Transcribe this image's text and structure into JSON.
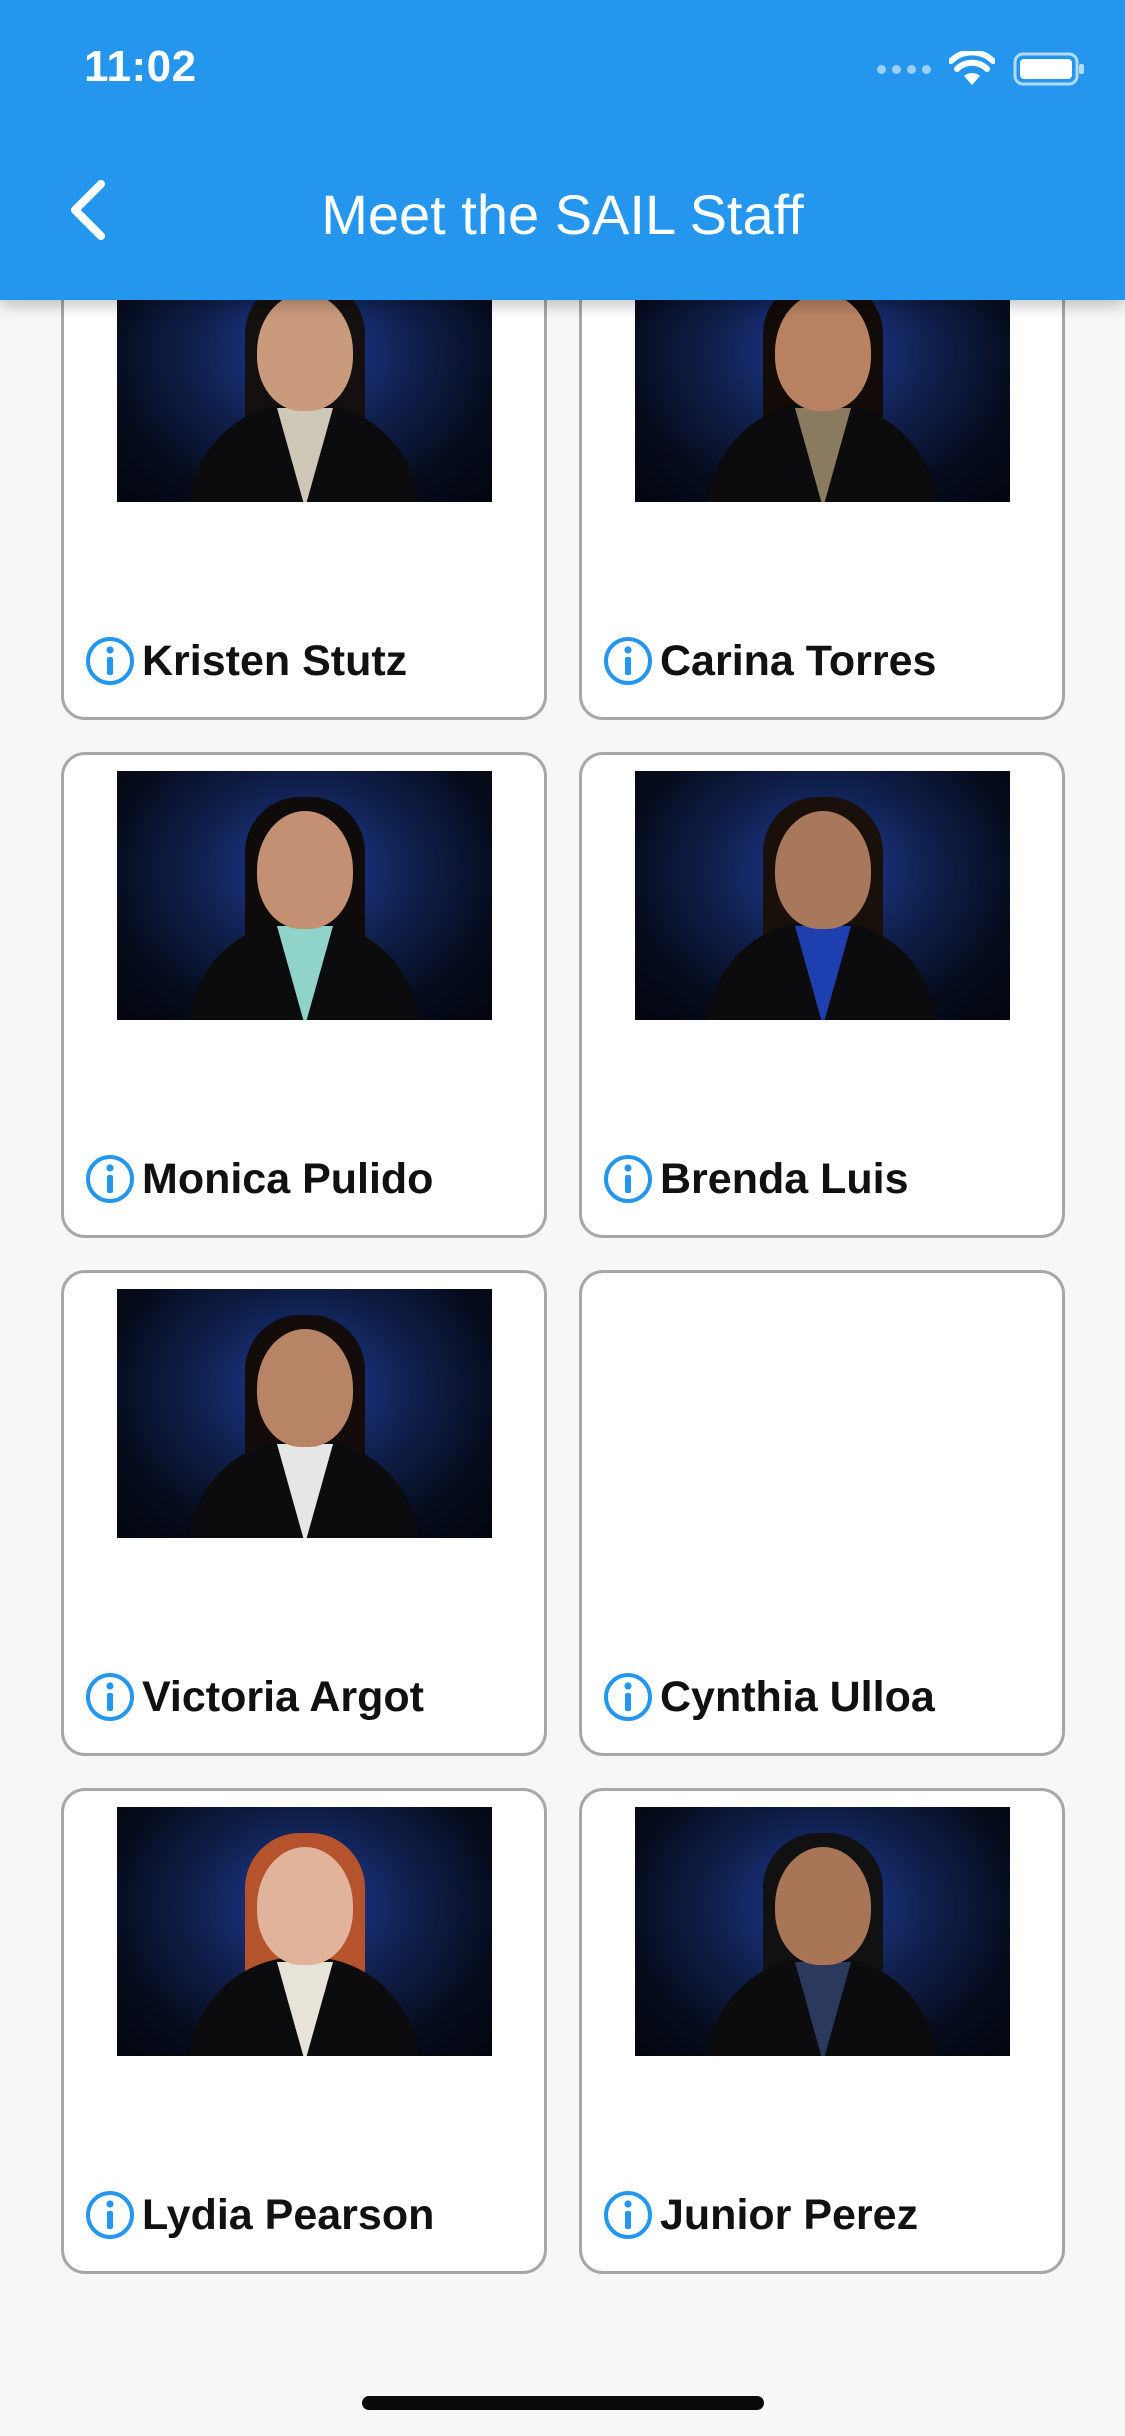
{
  "status_bar": {
    "time": "11:02"
  },
  "header": {
    "title": "Meet the SAIL Staff",
    "back_icon": "chevron-left-icon"
  },
  "colors": {
    "header": "#2596ee",
    "info_icon": "#2596ee",
    "card_border": "#a7a7a7"
  },
  "staff": [
    {
      "name": "Kristen Stutz",
      "has_photo": true,
      "shirt": "#cfc8b8",
      "hair": "#151010",
      "skin": "#c99a7c"
    },
    {
      "name": "Carina Torres",
      "has_photo": true,
      "shirt": "#8a7a60",
      "hair": "#120b08",
      "skin": "#b98363"
    },
    {
      "name": "Monica Pulido",
      "has_photo": true,
      "shirt": "#8fd3c9",
      "hair": "#0f0b0a",
      "skin": "#c39074"
    },
    {
      "name": "Brenda Luis",
      "has_photo": true,
      "shirt": "#1e3fb0",
      "hair": "#1a100b",
      "skin": "#a8785c"
    },
    {
      "name": "Victoria Argot",
      "has_photo": true,
      "shirt": "#e6e6e6",
      "hair": "#140b0b",
      "skin": "#b88466"
    },
    {
      "name": "Cynthia Ulloa",
      "has_photo": false
    },
    {
      "name": "Lydia Pearson",
      "has_photo": true,
      "shirt": "#e8e3d8",
      "hair": "#b5542c",
      "skin": "#e0b39a"
    },
    {
      "name": "Junior Perez",
      "has_photo": true,
      "shirt": "#2b3a5c",
      "hair": "#111",
      "skin": "#a87656"
    }
  ]
}
